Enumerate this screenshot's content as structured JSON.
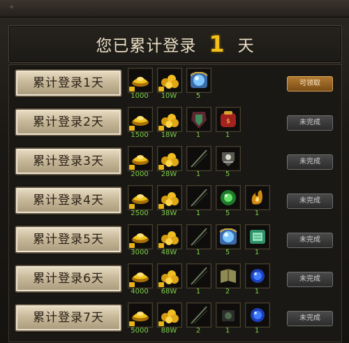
{
  "header": {
    "prefix": "您已累计登录",
    "days": "1",
    "suffix": "天"
  },
  "colors": {
    "gold": "#f2c018",
    "qty_green": "#7cd04a",
    "button_face": "#d6c8aa",
    "claim_orange": "#b27a32"
  },
  "rows": [
    {
      "label": "累计登录1天",
      "status": "可领取",
      "claimable": true,
      "items": [
        {
          "icon": "gold-ingot-icon",
          "qty": "1000"
        },
        {
          "icon": "gold-coins-icon",
          "qty": "10W"
        },
        {
          "icon": "blue-gem-icon",
          "qty": "5"
        }
      ]
    },
    {
      "label": "累计登录2天",
      "status": "未完成",
      "claimable": false,
      "items": [
        {
          "icon": "gold-ingot-icon",
          "qty": "1500"
        },
        {
          "icon": "gold-coins-icon",
          "qty": "18W"
        },
        {
          "icon": "armor-icon",
          "qty": "1"
        },
        {
          "icon": "red-bag-icon",
          "qty": "1"
        }
      ]
    },
    {
      "label": "累计登录3天",
      "status": "未完成",
      "claimable": false,
      "items": [
        {
          "icon": "gold-ingot-icon",
          "qty": "2000"
        },
        {
          "icon": "gold-coins-icon",
          "qty": "28W"
        },
        {
          "icon": "sword-icon",
          "qty": "1"
        },
        {
          "icon": "crest-icon",
          "qty": "5"
        }
      ]
    },
    {
      "label": "累计登录4天",
      "status": "未完成",
      "claimable": false,
      "items": [
        {
          "icon": "gold-ingot-icon",
          "qty": "2500"
        },
        {
          "icon": "gold-coins-icon",
          "qty": "38W"
        },
        {
          "icon": "sword-icon",
          "qty": "1"
        },
        {
          "icon": "green-orb-icon",
          "qty": "5"
        },
        {
          "icon": "flame-rune-icon",
          "qty": "1"
        }
      ]
    },
    {
      "label": "累计登录5天",
      "status": "未完成",
      "claimable": false,
      "items": [
        {
          "icon": "gold-ingot-icon",
          "qty": "3000"
        },
        {
          "icon": "gold-coins-icon",
          "qty": "48W"
        },
        {
          "icon": "sword-icon",
          "qty": "1"
        },
        {
          "icon": "blue-gem-icon",
          "qty": "5"
        },
        {
          "icon": "green-scroll-icon",
          "qty": "1"
        }
      ]
    },
    {
      "label": "累计登录6天",
      "status": "未完成",
      "claimable": false,
      "items": [
        {
          "icon": "gold-ingot-icon",
          "qty": "4000"
        },
        {
          "icon": "gold-coins-icon",
          "qty": "68W"
        },
        {
          "icon": "sword-icon",
          "qty": "1"
        },
        {
          "icon": "book-icon",
          "qty": "2"
        },
        {
          "icon": "blue-orb-icon",
          "qty": "1"
        }
      ]
    },
    {
      "label": "累计登录7天",
      "status": "未完成",
      "claimable": false,
      "items": [
        {
          "icon": "gold-ingot-icon",
          "qty": "5000"
        },
        {
          "icon": "gold-coins-icon",
          "qty": "88W"
        },
        {
          "icon": "sword-icon",
          "qty": "2"
        },
        {
          "icon": "dark-relic-icon",
          "qty": "1"
        },
        {
          "icon": "blue-orb-icon",
          "qty": "1"
        }
      ]
    }
  ]
}
